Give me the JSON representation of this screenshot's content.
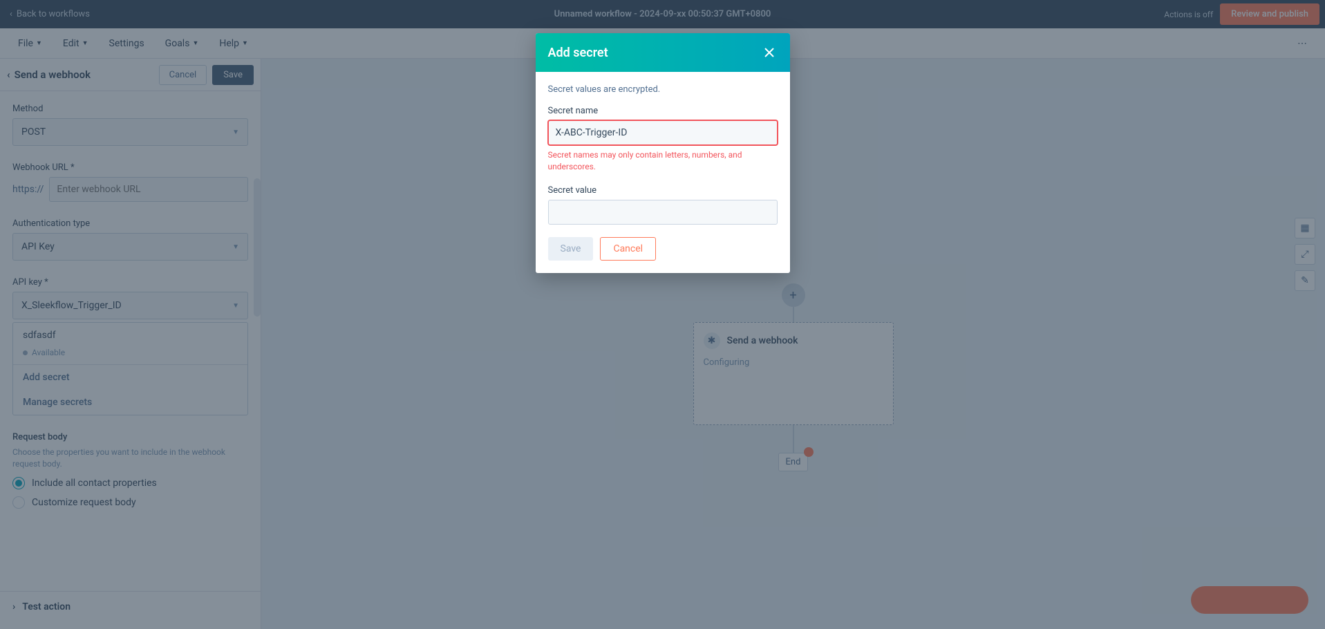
{
  "topbar": {
    "back": "Back to workflows",
    "title": "Unnamed workflow - 2024-09-xx 00:50:37 GMT+0800",
    "status": "Actions is off",
    "review": "Review and publish"
  },
  "nav2": {
    "items": [
      "File",
      "Edit",
      "Settings",
      "Goals",
      "Help"
    ]
  },
  "sidebar": {
    "header_title": "Send a webhook",
    "cancel": "Cancel",
    "save": "Save",
    "method_label": "Method",
    "method_value": "POST",
    "url_label": "Webhook URL *",
    "url_prefix": "https://",
    "url_placeholder": "Enter webhook URL",
    "auth_label": "Authentication type",
    "auth_value": "API Key",
    "apikey_label": "API key *",
    "apikey_value": "X_Sleekflow_Trigger_ID",
    "dd_item": "sdfasdf",
    "dd_status": "Available",
    "dd_add": "Add secret",
    "dd_manage": "Manage secrets",
    "body_label": "Request body",
    "body_help": "Choose the properties you want to include in the webhook request body.",
    "radio1": "Include all contact properties",
    "radio2": "Customize request body",
    "test_action": "Test action"
  },
  "canvas": {
    "card_title": "Send a webhook",
    "card_sub": "Configuring",
    "end": "End"
  },
  "modal": {
    "title": "Add secret",
    "note": "Secret values are encrypted.",
    "name_label": "Secret name",
    "name_value": "X-ABC-Trigger-ID",
    "name_error": "Secret names may only contain letters, numbers, and underscores.",
    "value_label": "Secret value",
    "save": "Save",
    "cancel": "Cancel"
  }
}
